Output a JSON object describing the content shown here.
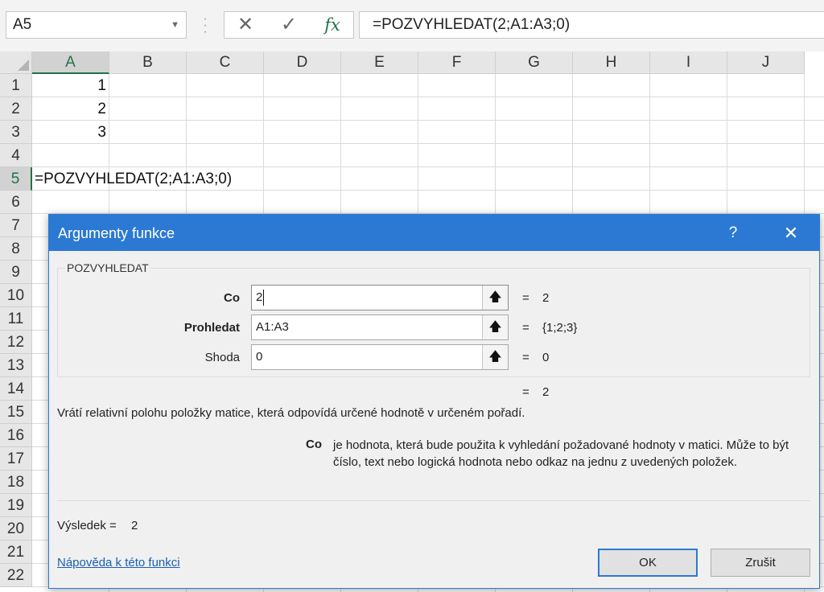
{
  "name_box": "A5",
  "formula_bar": {
    "cancel_glyph": "✕",
    "enter_glyph": "✓",
    "fx_label": "fx",
    "formula": "=POZVYHLEDAT(2;A1:A3;0)"
  },
  "columns": [
    "A",
    "B",
    "C",
    "D",
    "E",
    "F",
    "G",
    "H",
    "I",
    "J"
  ],
  "rows": [
    "1",
    "2",
    "3",
    "4",
    "5",
    "6",
    "7",
    "8",
    "9",
    "10",
    "11",
    "12",
    "13",
    "14",
    "15",
    "16",
    "17",
    "18",
    "19",
    "20",
    "21",
    "22"
  ],
  "cells": {
    "a1": "1",
    "a2": "2",
    "a3": "3",
    "a5": "=POZVYHLEDAT(2;A1:A3;0)"
  },
  "selected_cell": {
    "column": "A",
    "row": "5"
  },
  "dialog": {
    "title": "Argumenty funkce",
    "help_glyph": "?",
    "close_glyph": "✕",
    "function_name": "POZVYHLEDAT",
    "arguments": [
      {
        "label": "Co",
        "value": "2",
        "equals": "=",
        "result": "2"
      },
      {
        "label": "Prohledat",
        "value": "A1:A3",
        "equals": "=",
        "result": "{1;2;3}"
      },
      {
        "label": "Shoda",
        "value": "0",
        "equals": "=",
        "result": "0"
      }
    ],
    "formula_equals": "=",
    "formula_result": "2",
    "description": "Vrátí relativní polohu položky matice, která odpovídá určené hodnotě v určeném pořadí.",
    "active_argument_name": "Co",
    "active_argument_description": "je hodnota, která bude použita k vyhledání požadované hodnoty v matici. Může to být číslo, text nebo logická hodnota nebo odkaz na jednu z uvedených položek.",
    "result_label": "Výsledek =",
    "result_value": "2",
    "help_link": "Nápověda k této funkci",
    "ok_label": "OK",
    "cancel_label": "Zrušit",
    "collapse_glyph": "🡅"
  },
  "colors": {
    "excel_green": "#217346",
    "dialog_titlebar": "#2b79d3",
    "link": "#1a5fb4"
  }
}
